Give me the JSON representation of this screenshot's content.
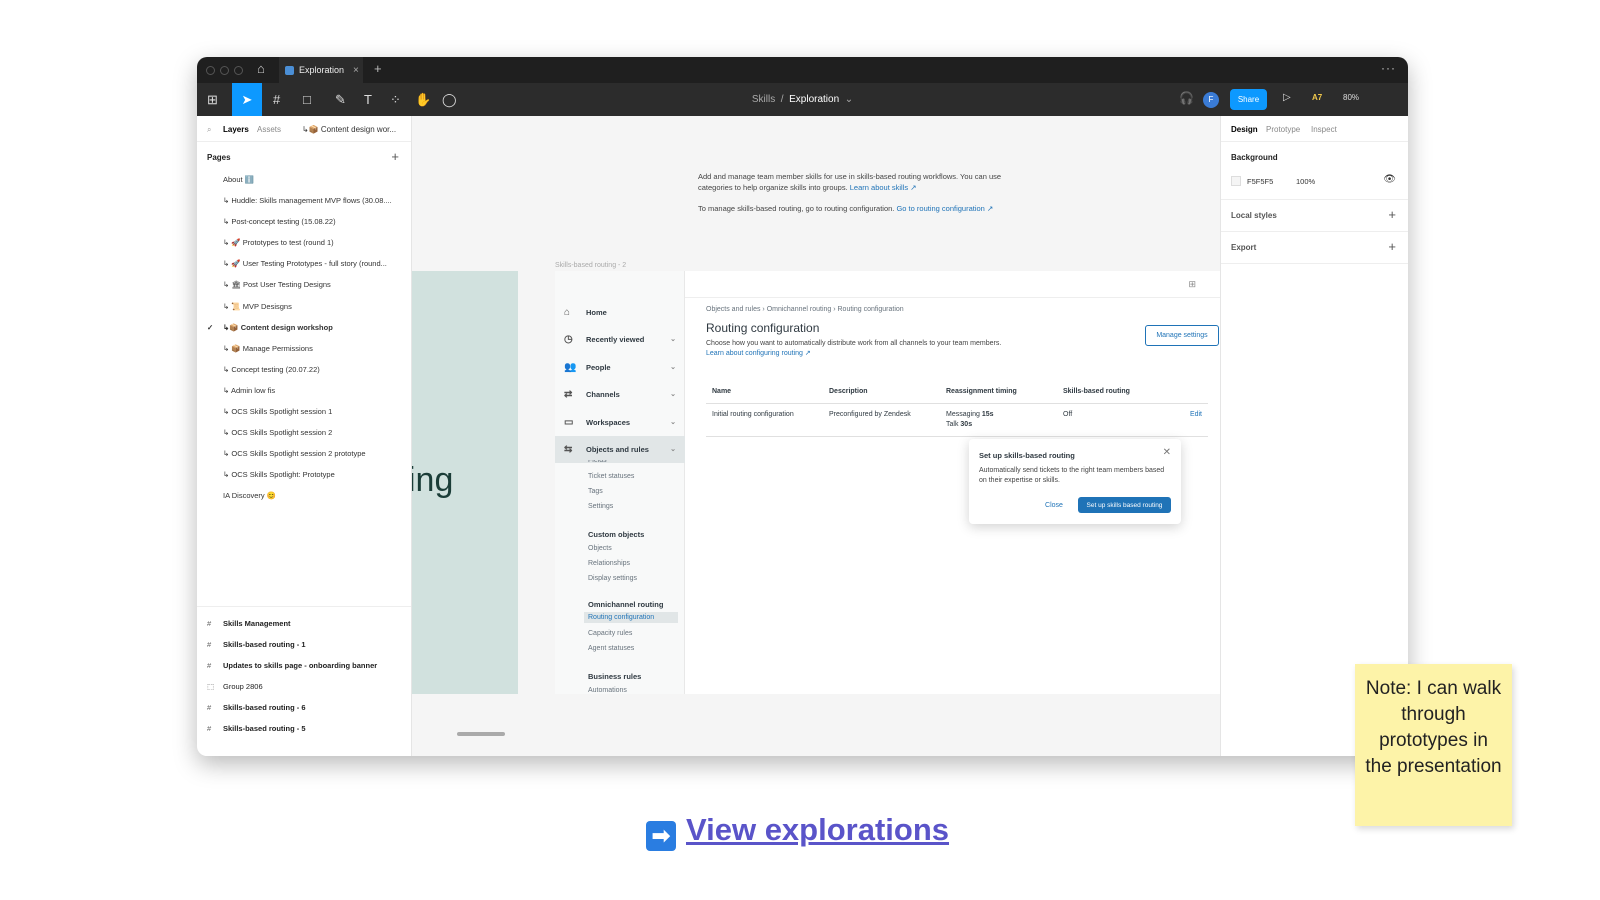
{
  "tabbar": {
    "file_tab": "Exploration",
    "close": "×",
    "add": "+",
    "more": "···",
    "home": "⌂"
  },
  "toolbar": {
    "crumb_parent": "Skills",
    "crumb_sep": "/",
    "crumb_current": "Exploration",
    "crumb_chevron": "⌄",
    "avatar": "F",
    "share": "Share",
    "play": "▷",
    "a7": "A7",
    "zoom": "80%",
    "tools": {
      "main_menu": "⊞",
      "move": "➤",
      "frame": "#",
      "shape": "□",
      "pen": "✎",
      "text": "T",
      "components": "⁘",
      "hand": "✋",
      "comment": "◯",
      "headphone": "🎧"
    }
  },
  "left_panel": {
    "tab_layers": "Layers",
    "tab_assets": "Assets",
    "current_page": "↳📦 Content design wor...",
    "pages_heading": "Pages",
    "add": "+",
    "pages": [
      "About ℹ️",
      "↳ Huddle: Skills management MVP flows (30.08....",
      "↳ Post-concept testing (15.08.22)",
      "↳ 🚀 Prototypes to test (round 1)",
      "↳ 🚀 User Testing Prototypes -  full story (round...",
      "↳ 🏛 Post User Testing Designs",
      "↳ 📜 MVP Desisgns",
      "↳📦 Content design workshop",
      "↳ 📦 Manage Permissions",
      "↳ Concept testing (20.07.22)",
      "↳ Admin low fis",
      "↳ OCS Skills Spotlight session 1",
      "↳ OCS Skills Spotlight session 2",
      "↳ OCS Skills Spotlight session 2 prototype",
      "↳ OCS Skills Spotlight: Prototype",
      "IA Discovery 😊"
    ],
    "active_page_index": 7,
    "check": "✓",
    "frames": [
      {
        "label": "Skills Management",
        "icon": "#"
      },
      {
        "label": "Skills-based routing - 1",
        "icon": "#"
      },
      {
        "label": "Updates to skills page - onboarding banner",
        "icon": "#"
      },
      {
        "label": "Group 2806",
        "icon": "⬚"
      },
      {
        "label": "Skills-based routing - 6",
        "icon": "#"
      },
      {
        "label": "Skills-based routing - 5",
        "icon": "#"
      }
    ]
  },
  "canvas": {
    "desc_1": "Add and manage team member skills for use in skills-based routing workflows. You can use categories to help organize skills into groups.",
    "desc_1_link": "Learn about skills ↗",
    "desc_2": "To manage skills-based routing, go to routing configuration.",
    "desc_2_link": "Go to routing configuration ↗",
    "teal_text": "ing",
    "frame_label": "Skills-based routing - 2"
  },
  "prototype": {
    "nav": [
      {
        "label": "Home",
        "icon": "⌂",
        "chevron": ""
      },
      {
        "label": "Recently viewed",
        "icon": "◷",
        "chevron": "⌄"
      },
      {
        "label": "People",
        "icon": "👥",
        "chevron": "⌄"
      },
      {
        "label": "Channels",
        "icon": "⇄",
        "chevron": "⌄"
      },
      {
        "label": "Workspaces",
        "icon": "▭",
        "chevron": "⌄"
      },
      {
        "label": "Objects and rules",
        "icon": "⇆",
        "chevron": "⌄"
      }
    ],
    "sub_fields": "Fields",
    "sub_ticket_statuses": "Ticket statuses",
    "sub_tags": "Tags",
    "sub_settings": "Settings",
    "sub_custom_objects": "Custom objects",
    "sub_objects": "Objects",
    "sub_relationships": "Relationships",
    "sub_display_settings": "Display settings",
    "sub_omnichannel": "Omnichannel routing",
    "sub_routing_config": "Routing configuration",
    "sub_capacity": "Capacity rules",
    "sub_agent_statuses": "Agent statuses",
    "sub_business_rules": "Business rules",
    "sub_automations": "Automations",
    "grid_icon": "⊞",
    "breadcrumb": "Objects and rules  ›  Omnichannel routing  ›  Routing configuration",
    "title": "Routing configuration",
    "subtitle": "Choose how you want to automatically distribute work from all channels to your team members.",
    "subtitle_link": "Learn about configuring routing ↗",
    "manage_settings": "Manage settings",
    "table": {
      "headers": [
        "Name",
        "Description",
        "Reassignment timing",
        "Skills-based routing",
        ""
      ],
      "row": {
        "name": "Initial routing configuration",
        "description": "Preconfigured by Zendesk",
        "timing_messaging_label": "Messaging",
        "timing_messaging_value": "15s",
        "timing_talk_label": "Talk",
        "timing_talk_value": "30s",
        "skills": "Off",
        "edit": "Edit"
      }
    },
    "popup": {
      "title": "Set up skills-based routing",
      "close_x": "✕",
      "body": "Automatically send tickets to the right team members based on their expertise or skills.",
      "close": "Close",
      "primary": "Set up skills based routing"
    }
  },
  "right_panel": {
    "tab_design": "Design",
    "tab_prototype": "Prototype",
    "tab_inspect": "Inspect",
    "background_heading": "Background",
    "bg_hex": "F5F5F5",
    "bg_opacity": "100%",
    "eye": "👁",
    "local_styles": "Local styles",
    "export": "Export",
    "plus": "+"
  },
  "sticky_note": "Note: I can walk through prototypes in the presentation",
  "view_link": {
    "arrow": "➡",
    "label": "View explorations"
  },
  "colors": {
    "accent": "#0d99ff",
    "zendesk_blue": "#1f73b7",
    "teal_frame": "#d1e1de",
    "sticky": "#fdf3a8",
    "link": "#5a54c9"
  }
}
